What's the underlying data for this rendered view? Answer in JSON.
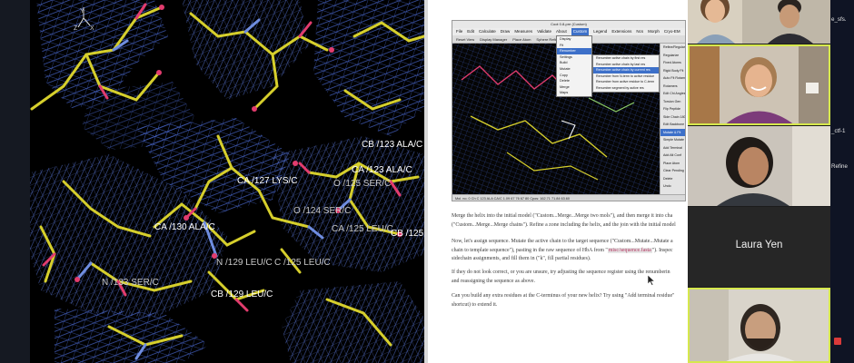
{
  "viewer": {
    "axis_labels": [
      "Y",
      "Z",
      "X"
    ],
    "residue_labels": [
      "CB /123 ALA/C",
      "CA /123 ALA/C",
      "CA /127 LYS/C",
      "O /125 SER/C",
      "O /124 SER/C",
      "CA /130 ALA/C",
      "CA /125 LEU/C",
      "CB /125",
      "N /129 LEU/C",
      "C /125 LEU/C",
      "N /133 SER/C",
      "CB /129 LEU/C"
    ],
    "colors": {
      "carbon": "#d6cf2c",
      "nitrogen": "#6f8de0",
      "oxygen": "#e23c6e",
      "density_map": "#4f6fd8"
    }
  },
  "document": {
    "embedded_screenshot": {
      "title": "Coot 0.8-pre (Custom)",
      "menubar": [
        "File",
        "Edit",
        "Calculate",
        "Draw",
        "Measures",
        "Validate",
        "About",
        "Custom",
        "Legend",
        "Extensions",
        "Ncs",
        "Morph",
        "Cryo-EM"
      ],
      "toolbar": [
        "Reset View",
        "Display Manager",
        "Place Atom",
        "Sphere Refine"
      ],
      "custom_menu": [
        "Display",
        "Fit",
        "Renumber",
        "Settings",
        "Build",
        "Mutate",
        "Copy",
        "Delete",
        "Merge",
        "Maps"
      ],
      "renumber_submenu": [
        "Renumber active chain by first res",
        "Renumber active chain by last res",
        "Renumber active chain by current res",
        "Renumber from N-term to active residue",
        "Renumber from active residue to C-term",
        "Renumber segment by active res"
      ],
      "side_panel": [
        "Refine/Regularize",
        "Regularize",
        "Fixed Atoms",
        "Rigid Body Fit",
        "Auto Fit Rotamer",
        "Rotamers",
        "Edit Chi Angles",
        "Torsion Gen",
        "Flip Peptide",
        "Side Chain 180",
        "Edit Backbone",
        "Mutate & Fit",
        "Simple Mutate",
        "Add Terminal",
        "Add Alt Conf",
        "Place Atom",
        "Clear Pending",
        "Delete",
        "Undo",
        "Redo"
      ],
      "status": "Mol. no. 0 Ch C 123 ALA CA/C  1.09 67 76 67 80  Cpos: 162.71 71.84 63.60"
    },
    "paragraphs": [
      {
        "lines": [
          "Merge the helix into the initial model (\"Custom...Merge...Merge two mols\"), and then merge it into cha",
          "(\"Custom...Merge...Merge chains\"). Refine a zone including the helix, and the join with the initial model"
        ]
      },
      {
        "lines_before_code": "Now, let's assign sequence. Mutate the active chain to the target sequence (\"Custom...Mutate...Mutate a",
        "line2_prefix": "chain to template sequence\"), pasting in the raw sequence of HbA from \"",
        "code": "misc/sequence.fasta",
        "line2_suffix": "\"). Inspec",
        "line3": "sidechain assignments, and fill them in (\"k\", fill partial residues)."
      },
      {
        "lines": [
          "If they do not look correct, or you are unsure, try adjusting the sequence register using the renumberin",
          "and reassigning the sequence as above."
        ]
      },
      {
        "lines": [
          "Can you build any extra residues at the C-terminus of your new helix? Try using \"Add terminal residue\"",
          "shortcut) to extend it."
        ]
      }
    ]
  },
  "call": {
    "participant_name": "Laura Yen",
    "desktop_labels": [
      "e_sfs.",
      "_ctf-1",
      "Refine"
    ],
    "colors": {
      "active_speaker_border": "#d6e84d",
      "tile_background": "#262626"
    }
  }
}
